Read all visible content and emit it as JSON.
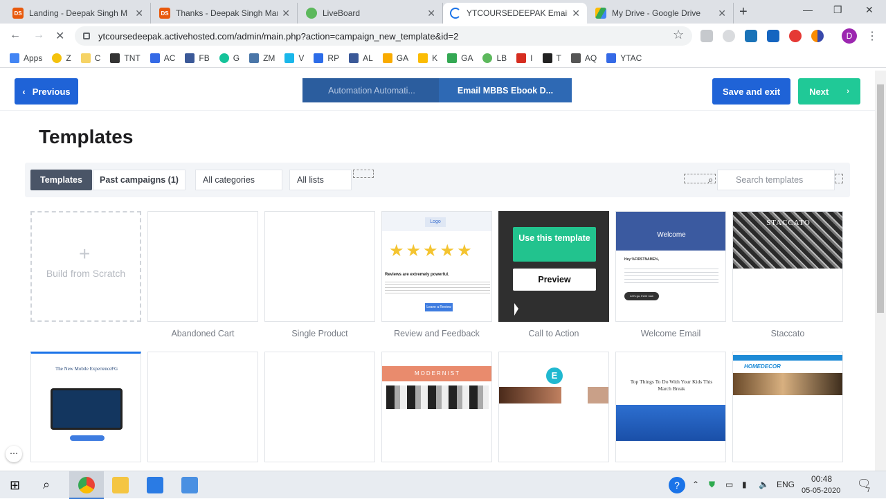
{
  "browser": {
    "tabs": [
      {
        "title": "Landing - Deepak Singh M",
        "icon": "ds-icon",
        "color": "#e8590c"
      },
      {
        "title": "Thanks - Deepak Singh Mar",
        "icon": "ds-icon",
        "color": "#e8590c"
      },
      {
        "title": "LiveBoard",
        "icon": "liveboard-icon",
        "color": "#5cb85c"
      },
      {
        "title": "YTCOURSEDEEPAK Email M",
        "icon": "loading-icon",
        "color": "#1a73e8"
      },
      {
        "title": "My Drive - Google Drive",
        "icon": "drive-icon",
        "color": "#fbbc04"
      }
    ],
    "ds_label": "DS",
    "address": "ytcoursedeepak.activehosted.com/admin/main.php?action=campaign_new_template&id=2",
    "profile_initial": "D",
    "bookmarks": [
      {
        "label": "Apps",
        "color": "#4285f4"
      },
      {
        "label": "Z",
        "color": "#f4c20d"
      },
      {
        "label": "C",
        "color": "#f6d365"
      },
      {
        "label": "TNT",
        "color": "#333333"
      },
      {
        "label": "AC",
        "color": "#356ae6"
      },
      {
        "label": "FB",
        "color": "#3b5998"
      },
      {
        "label": "G",
        "color": "#15c39a"
      },
      {
        "label": "ZM",
        "color": "#4a76a8"
      },
      {
        "label": "V",
        "color": "#1ab7ea"
      },
      {
        "label": "RP",
        "color": "#2c6ce8"
      },
      {
        "label": "AL",
        "color": "#3b5998"
      },
      {
        "label": "GA",
        "color": "#f9ab00"
      },
      {
        "label": "K",
        "color": "#fbbc04"
      },
      {
        "label": "GA",
        "color": "#34a853"
      },
      {
        "label": "LB",
        "color": "#5cb85c"
      },
      {
        "label": "I",
        "color": "#d62d20"
      },
      {
        "label": "T",
        "color": "#222222"
      },
      {
        "label": "AQ",
        "color": "#555555"
      },
      {
        "label": "YTAC",
        "color": "#356ae6"
      }
    ]
  },
  "header": {
    "previous_label": "Previous",
    "crumb_1": "Automation Automati...",
    "crumb_2": "Email MBBS Ebook D...",
    "save_label": "Save and exit",
    "next_label": "Next"
  },
  "page": {
    "title": "Templates",
    "tab_templates": "Templates",
    "tab_past": "Past campaigns (1)",
    "categories": "All categories",
    "lists": "All lists",
    "search_placeholder": "Search templates"
  },
  "templates": [
    {
      "name": "",
      "label": "Build from Scratch"
    },
    {
      "name": "Abandoned Cart"
    },
    {
      "name": "Single Product"
    },
    {
      "name": "Review and Feedback"
    },
    {
      "name": "Call to Action"
    },
    {
      "name": "Welcome Email"
    },
    {
      "name": "Staccato"
    }
  ],
  "hover": {
    "use_label": "Use this template",
    "preview_label": "Preview"
  },
  "thumb_text": {
    "logo": "Logo",
    "review_headline": "Reviews are extremely powerful.",
    "review_button": "Leave a Review",
    "welcome": "Welcome",
    "welcome_greet": "Hey %FIRSTNAME%,",
    "welcome_btn": "Let's go, there now",
    "staccato": "STACCATO",
    "mobile": "The New Mobile ExperienceFG",
    "modernist": "MODERNIST",
    "e_letter": "E",
    "playground": "Top Things To Do With Your Kids This March Break",
    "homedecor": "HOMEDECOR"
  },
  "taskbar": {
    "lang": "ENG",
    "time": "00:48",
    "date": "05-05-2020",
    "notif": "7"
  }
}
